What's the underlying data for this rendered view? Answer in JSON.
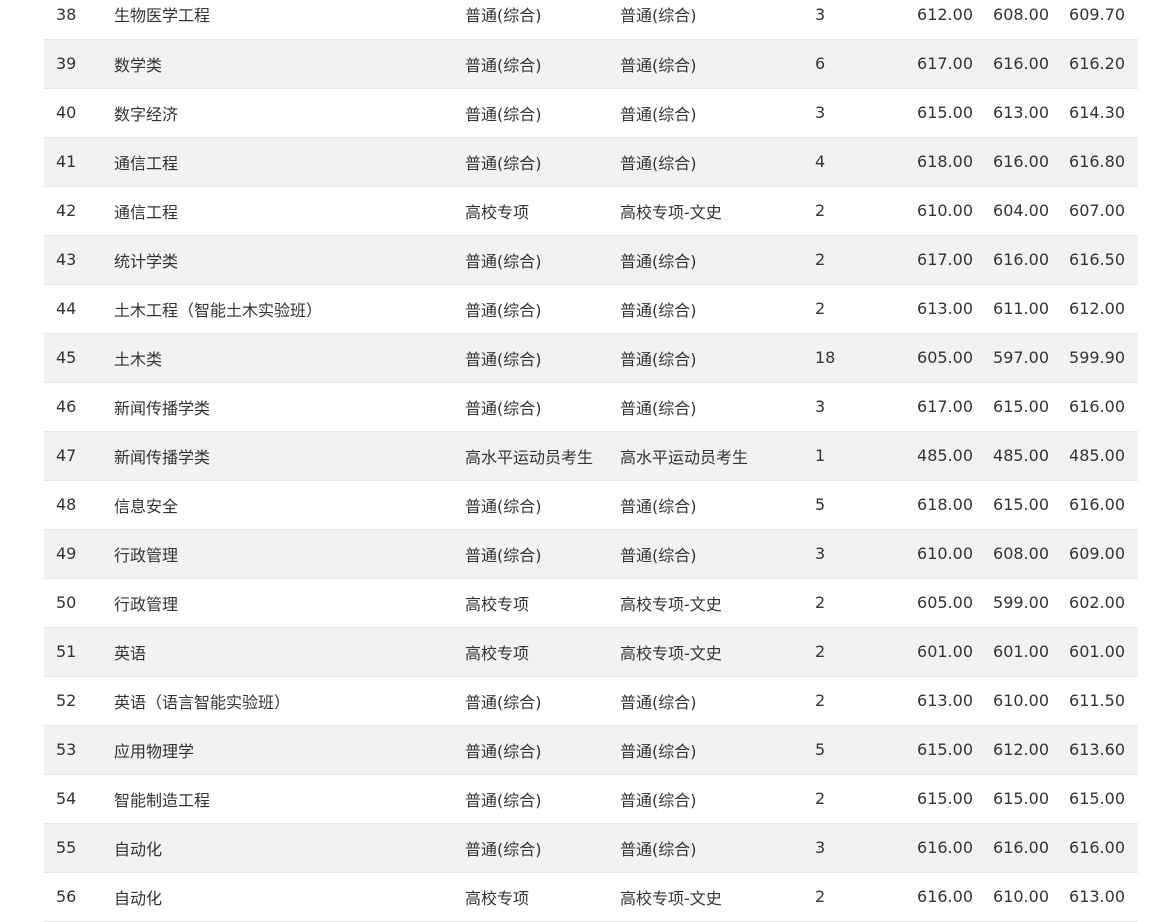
{
  "rows": [
    {
      "no": "38",
      "major": "生物医学工程",
      "type": "普通(综合)",
      "group": "普通(综合)",
      "count": "3",
      "max": "612.00",
      "min": "608.00",
      "avg": "609.70"
    },
    {
      "no": "39",
      "major": "数学类",
      "type": "普通(综合)",
      "group": "普通(综合)",
      "count": "6",
      "max": "617.00",
      "min": "616.00",
      "avg": "616.20"
    },
    {
      "no": "40",
      "major": "数字经济",
      "type": "普通(综合)",
      "group": "普通(综合)",
      "count": "3",
      "max": "615.00",
      "min": "613.00",
      "avg": "614.30"
    },
    {
      "no": "41",
      "major": "通信工程",
      "type": "普通(综合)",
      "group": "普通(综合)",
      "count": "4",
      "max": "618.00",
      "min": "616.00",
      "avg": "616.80"
    },
    {
      "no": "42",
      "major": "通信工程",
      "type": "高校专项",
      "group": "高校专项-文史",
      "count": "2",
      "max": "610.00",
      "min": "604.00",
      "avg": "607.00"
    },
    {
      "no": "43",
      "major": "统计学类",
      "type": "普通(综合)",
      "group": "普通(综合)",
      "count": "2",
      "max": "617.00",
      "min": "616.00",
      "avg": "616.50"
    },
    {
      "no": "44",
      "major": "土木工程（智能土木实验班）",
      "type": "普通(综合)",
      "group": "普通(综合)",
      "count": "2",
      "max": "613.00",
      "min": "611.00",
      "avg": "612.00"
    },
    {
      "no": "45",
      "major": "土木类",
      "type": "普通(综合)",
      "group": "普通(综合)",
      "count": "18",
      "max": "605.00",
      "min": "597.00",
      "avg": "599.90"
    },
    {
      "no": "46",
      "major": "新闻传播学类",
      "type": "普通(综合)",
      "group": "普通(综合)",
      "count": "3",
      "max": "617.00",
      "min": "615.00",
      "avg": "616.00"
    },
    {
      "no": "47",
      "major": "新闻传播学类",
      "type": "高水平运动员考生",
      "group": "高水平运动员考生",
      "count": "1",
      "max": "485.00",
      "min": "485.00",
      "avg": "485.00"
    },
    {
      "no": "48",
      "major": "信息安全",
      "type": "普通(综合)",
      "group": "普通(综合)",
      "count": "5",
      "max": "618.00",
      "min": "615.00",
      "avg": "616.00"
    },
    {
      "no": "49",
      "major": "行政管理",
      "type": "普通(综合)",
      "group": "普通(综合)",
      "count": "3",
      "max": "610.00",
      "min": "608.00",
      "avg": "609.00"
    },
    {
      "no": "50",
      "major": "行政管理",
      "type": "高校专项",
      "group": "高校专项-文史",
      "count": "2",
      "max": "605.00",
      "min": "599.00",
      "avg": "602.00"
    },
    {
      "no": "51",
      "major": "英语",
      "type": "高校专项",
      "group": "高校专项-文史",
      "count": "2",
      "max": "601.00",
      "min": "601.00",
      "avg": "601.00"
    },
    {
      "no": "52",
      "major": "英语（语言智能实验班）",
      "type": "普通(综合)",
      "group": "普通(综合)",
      "count": "2",
      "max": "613.00",
      "min": "610.00",
      "avg": "611.50"
    },
    {
      "no": "53",
      "major": "应用物理学",
      "type": "普通(综合)",
      "group": "普通(综合)",
      "count": "5",
      "max": "615.00",
      "min": "612.00",
      "avg": "613.60"
    },
    {
      "no": "54",
      "major": "智能制造工程",
      "type": "普通(综合)",
      "group": "普通(综合)",
      "count": "2",
      "max": "615.00",
      "min": "615.00",
      "avg": "615.00"
    },
    {
      "no": "55",
      "major": "自动化",
      "type": "普通(综合)",
      "group": "普通(综合)",
      "count": "3",
      "max": "616.00",
      "min": "616.00",
      "avg": "616.00"
    },
    {
      "no": "56",
      "major": "自动化",
      "type": "高校专项",
      "group": "高校专项-文史",
      "count": "2",
      "max": "616.00",
      "min": "610.00",
      "avg": "613.00"
    }
  ]
}
